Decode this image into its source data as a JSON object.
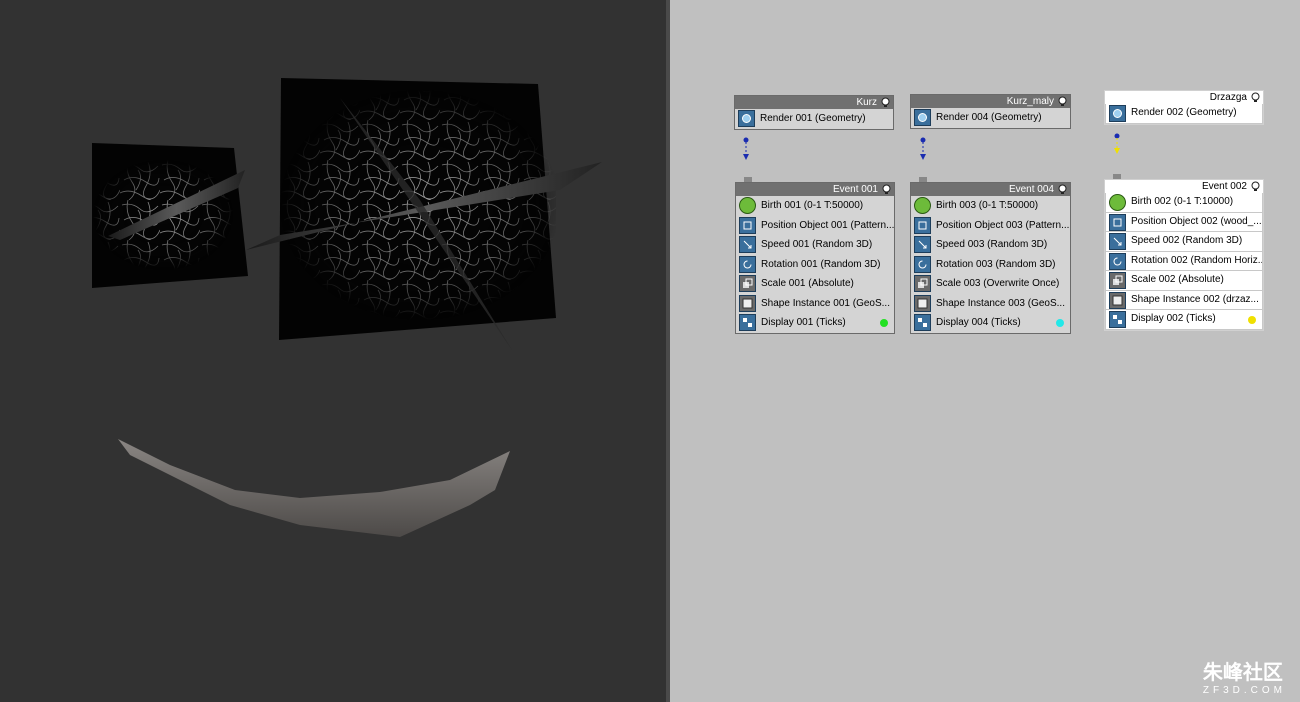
{
  "nodes": {
    "kurz": {
      "title": "Kurz",
      "ops": [
        "Render 001 (Geometry)"
      ]
    },
    "kurz_maly": {
      "title": "Kurz_maly",
      "ops": [
        "Render 004 (Geometry)"
      ]
    },
    "drzazga": {
      "title": "Drzazga",
      "ops": [
        "Render 002 (Geometry)"
      ]
    },
    "event001": {
      "title": "Event 001",
      "ops": [
        "Birth 001 (0-1 T:50000)",
        "Position Object 001 (Pattern...",
        "Speed 001 (Random 3D)",
        "Rotation 001 (Random 3D)",
        "Scale 001 (Absolute)",
        "Shape Instance 001 (GeoS...",
        "Display 001 (Ticks)"
      ],
      "display_color": "#22e022"
    },
    "event004": {
      "title": "Event 004",
      "ops": [
        "Birth 003 (0-1 T:50000)",
        "Position Object 003 (Pattern...",
        "Speed 003 (Random 3D)",
        "Rotation 003 (Random 3D)",
        "Scale 003 (Overwrite Once)",
        "Shape Instance 003 (GeoS...",
        "Display 004 (Ticks)"
      ],
      "display_color": "#22e8e8"
    },
    "event002": {
      "title": "Event 002",
      "ops": [
        "Birth 002 (0-1 T:10000)",
        "Position Object 002 (wood_...",
        "Speed 002 (Random 3D)",
        "Rotation 002 (Random Horiz...",
        "Scale 002 (Absolute)",
        "Shape Instance 002 (drzaz...",
        "Display 002 (Ticks)"
      ],
      "display_color": "#f0e000"
    }
  },
  "op_icons": [
    "birth-icon",
    "position-object-icon",
    "speed-icon",
    "rotation-icon",
    "scale-icon",
    "shape-instance-icon",
    "display-icon"
  ],
  "watermark": {
    "text": "朱峰社区",
    "sub": "ZF3D.COM"
  }
}
